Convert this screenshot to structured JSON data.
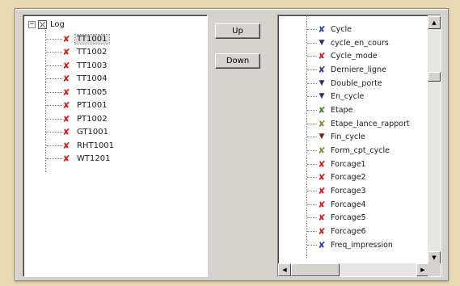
{
  "colors": {
    "red_x": "#cc1f1f",
    "blue_x": "#2b3fb0",
    "green_x": "#3f8a2a",
    "olive_x": "#8a8a3a",
    "navy_triangle": "#2b2f7a",
    "maroon_triangle": "#7a1f1f"
  },
  "buttons": {
    "up_label": "Up",
    "down_label": "Down"
  },
  "tree": {
    "root_label": "Log",
    "expander_symbol": "−",
    "items": [
      {
        "label": "TT1001",
        "icon": "x-mark-icon",
        "selected": true
      },
      {
        "label": "TT1002",
        "icon": "x-mark-icon"
      },
      {
        "label": "TT1003",
        "icon": "x-mark-icon"
      },
      {
        "label": "TT1004",
        "icon": "x-mark-icon"
      },
      {
        "label": "TT1005",
        "icon": "x-mark-icon"
      },
      {
        "label": "PT1001",
        "icon": "x-mark-icon"
      },
      {
        "label": "PT1002",
        "icon": "x-mark-icon"
      },
      {
        "label": "GT1001",
        "icon": "x-mark-icon"
      },
      {
        "label": "RHT1001",
        "icon": "x-mark-icon"
      },
      {
        "label": "WT1201",
        "icon": "x-mark-icon"
      }
    ]
  },
  "variables": {
    "items": [
      {
        "label": "Cycle",
        "icon": "x-mark-icon",
        "color": "blue"
      },
      {
        "label": "cycle_en_cours",
        "icon": "triangle-down-icon",
        "color": "navy"
      },
      {
        "label": "Cycle_mode",
        "icon": "x-mark-icon",
        "color": "red"
      },
      {
        "label": "Derniere_ligne",
        "icon": "x-mark-icon",
        "color": "blue"
      },
      {
        "label": "Double_porte",
        "icon": "triangle-down-icon",
        "color": "navy"
      },
      {
        "label": "En_cycle",
        "icon": "triangle-down-icon",
        "color": "navy"
      },
      {
        "label": "Etape",
        "icon": "x-mark-icon",
        "color": "green"
      },
      {
        "label": "Etape_lance_rapport",
        "icon": "x-mark-icon",
        "color": "olive"
      },
      {
        "label": "Fin_cycle",
        "icon": "triangle-down-icon",
        "color": "maroon"
      },
      {
        "label": "Form_cpt_cycle",
        "icon": "x-mark-icon",
        "color": "olive"
      },
      {
        "label": "Forcage1",
        "icon": "x-mark-icon",
        "color": "red"
      },
      {
        "label": "Forcage2",
        "icon": "x-mark-icon",
        "color": "red"
      },
      {
        "label": "Forcage3",
        "icon": "x-mark-icon",
        "color": "red"
      },
      {
        "label": "Forcage4",
        "icon": "x-mark-icon",
        "color": "red"
      },
      {
        "label": "Forcage5",
        "icon": "x-mark-icon",
        "color": "red"
      },
      {
        "label": "Forcage6",
        "icon": "x-mark-icon",
        "color": "red"
      },
      {
        "label": "Freq_impression",
        "icon": "x-mark-icon",
        "color": "blue"
      }
    ]
  },
  "scrollbars": {
    "up_arrow": "▲",
    "down_arrow": "▼",
    "left_arrow": "◀",
    "right_arrow": "▶"
  }
}
